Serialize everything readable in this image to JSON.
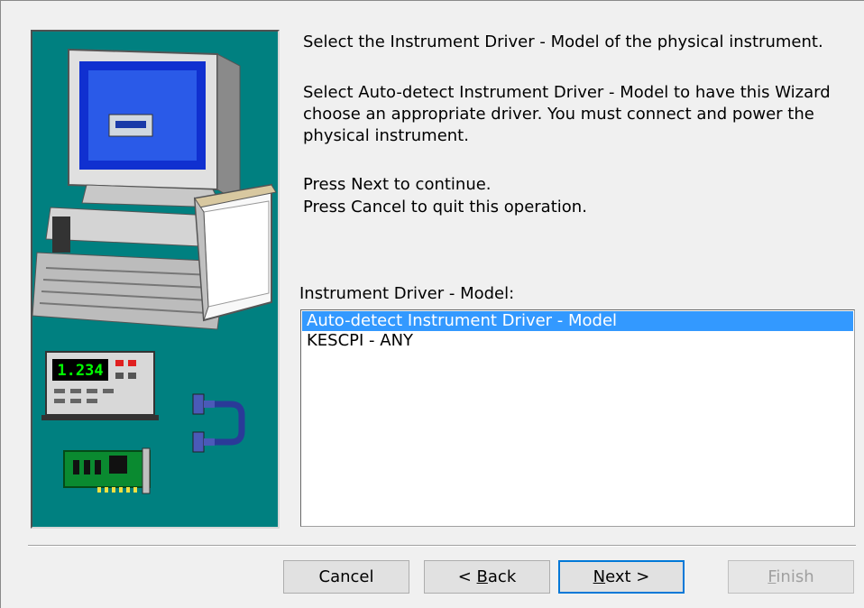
{
  "instructions": {
    "line1": "Select the Instrument Driver - Model of the physical instrument.",
    "line2": "Select Auto-detect Instrument Driver - Model to have this Wizard choose an appropriate driver. You must connect and power the physical instrument.",
    "line3": "Press Next to continue.",
    "line4": "Press Cancel to quit this operation."
  },
  "driver_list": {
    "label": "Instrument Driver - Model:",
    "items": [
      {
        "label": "Auto-detect Instrument Driver - Model",
        "selected": true
      },
      {
        "label": "KESCPI - ANY",
        "selected": false
      }
    ]
  },
  "illustration": {
    "meter_display": "1.234"
  },
  "buttons": {
    "cancel": "Cancel",
    "back_prefix": "< ",
    "back_key": "B",
    "back_rest": "ack",
    "next_key": "N",
    "next_rest": "ext >",
    "finish_key": "F",
    "finish_rest": "inish"
  },
  "colors": {
    "panel_background": "#008080",
    "selection": "#3399ff",
    "default_button_border": "#0078d7"
  }
}
